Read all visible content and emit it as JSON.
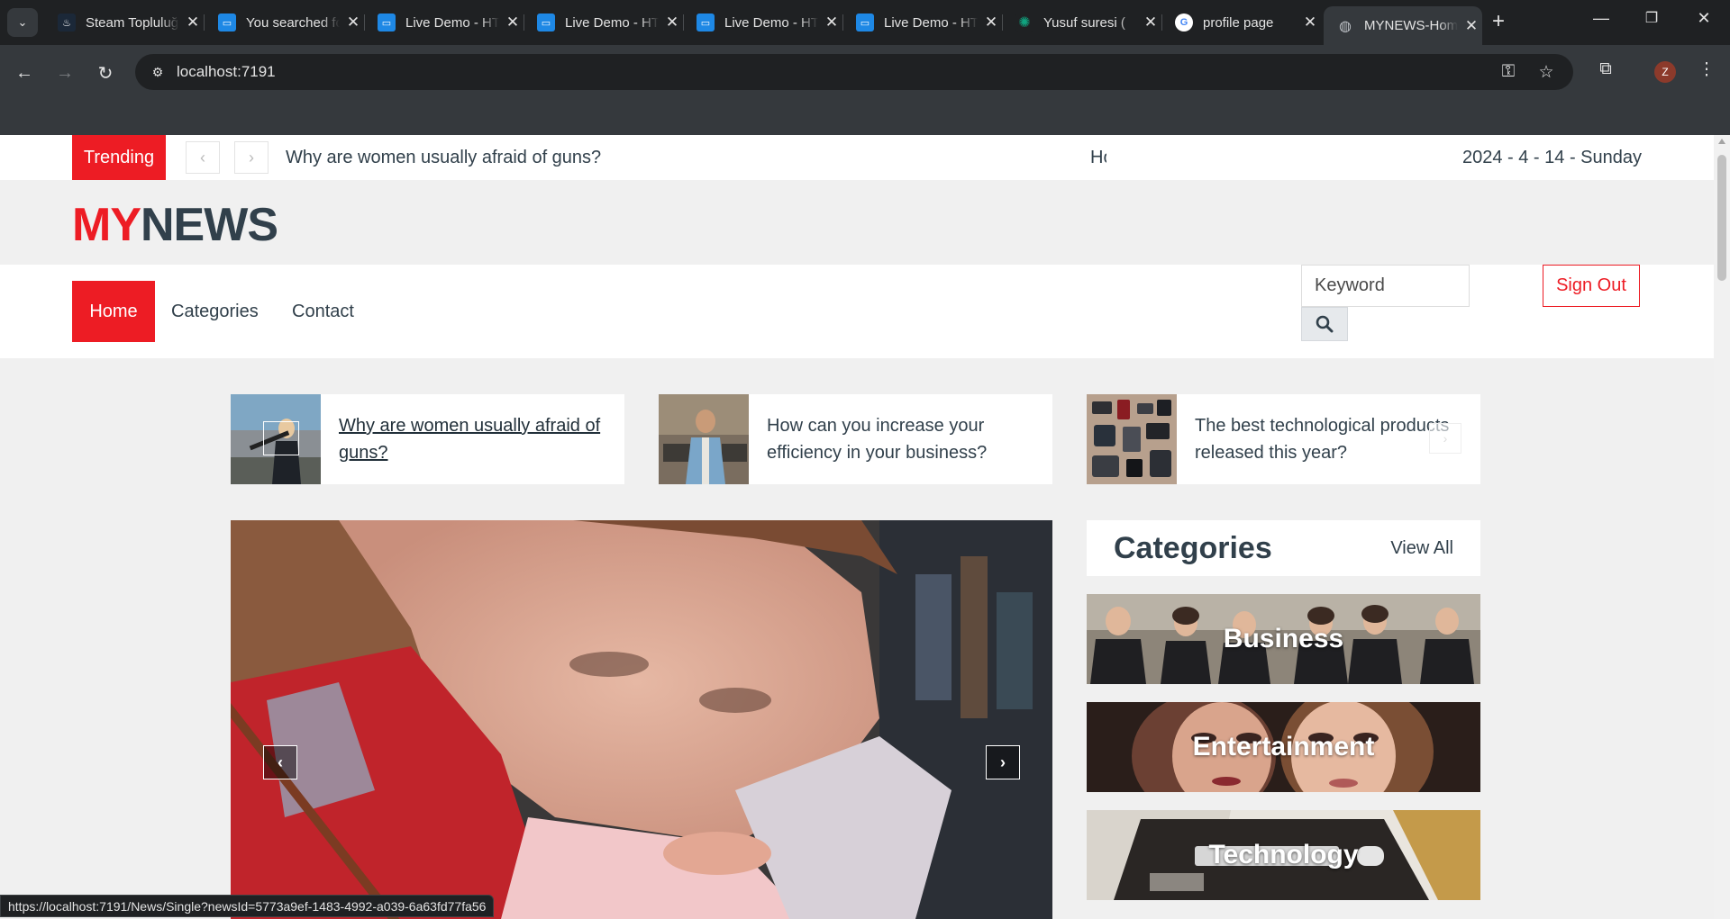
{
  "browser": {
    "tabs": [
      {
        "label": "Steam Topluluğu",
        "favicon": "steam-icon",
        "color": "#1b2838"
      },
      {
        "label": "You searched for",
        "favicon": "live-demo-icon",
        "color": "#1e88e5"
      },
      {
        "label": "Live Demo - HTML",
        "favicon": "live-demo-icon",
        "color": "#1e88e5"
      },
      {
        "label": "Live Demo - HTML",
        "favicon": "live-demo-icon",
        "color": "#1e88e5"
      },
      {
        "label": "Live Demo - HTML",
        "favicon": "live-demo-icon",
        "color": "#1e88e5"
      },
      {
        "label": "Live Demo - HTML",
        "favicon": "live-demo-icon",
        "color": "#1e88e5"
      },
      {
        "label": "Yusuf suresi (",
        "favicon": "openai-icon",
        "color": "#10a37f"
      },
      {
        "label": "profile page ",
        "favicon": "google-icon",
        "color": "#ffffff"
      },
      {
        "label": "MYNEWS-Home",
        "favicon": "globe-icon",
        "color": "#9aa0a6"
      }
    ],
    "url": "localhost:7191",
    "profile_initial": "Z",
    "status_url": "https://localhost:7191/News/Single?newsId=5773a9ef-1483-4992-a039-6a63fd77fa56"
  },
  "site": {
    "trending": {
      "label": "Trending",
      "items": [
        "Why are women usually afraid of guns?",
        "How can you increase your efficiency in your business?"
      ],
      "date": "2024 - 4 - 14 - Sunday"
    },
    "logo": {
      "part1": "MY",
      "part2": "NEWS"
    },
    "nav": {
      "home": "Home",
      "categories": "Categories",
      "contact": "Contact"
    },
    "search": {
      "placeholder": "Keyword"
    },
    "sign_out": "Sign Out",
    "featured": [
      {
        "title": "Why are women usually afraid of guns?"
      },
      {
        "title": "How can you increase your efficiency in your business?"
      },
      {
        "title": "The best technological products released this year?"
      }
    ],
    "categories": {
      "title": "Categories",
      "view_all": "View All",
      "items": [
        "Business",
        "Entertainment",
        "Technology"
      ]
    }
  },
  "colors": {
    "brand_red": "#ed1c24",
    "dark_text": "#31404b"
  }
}
